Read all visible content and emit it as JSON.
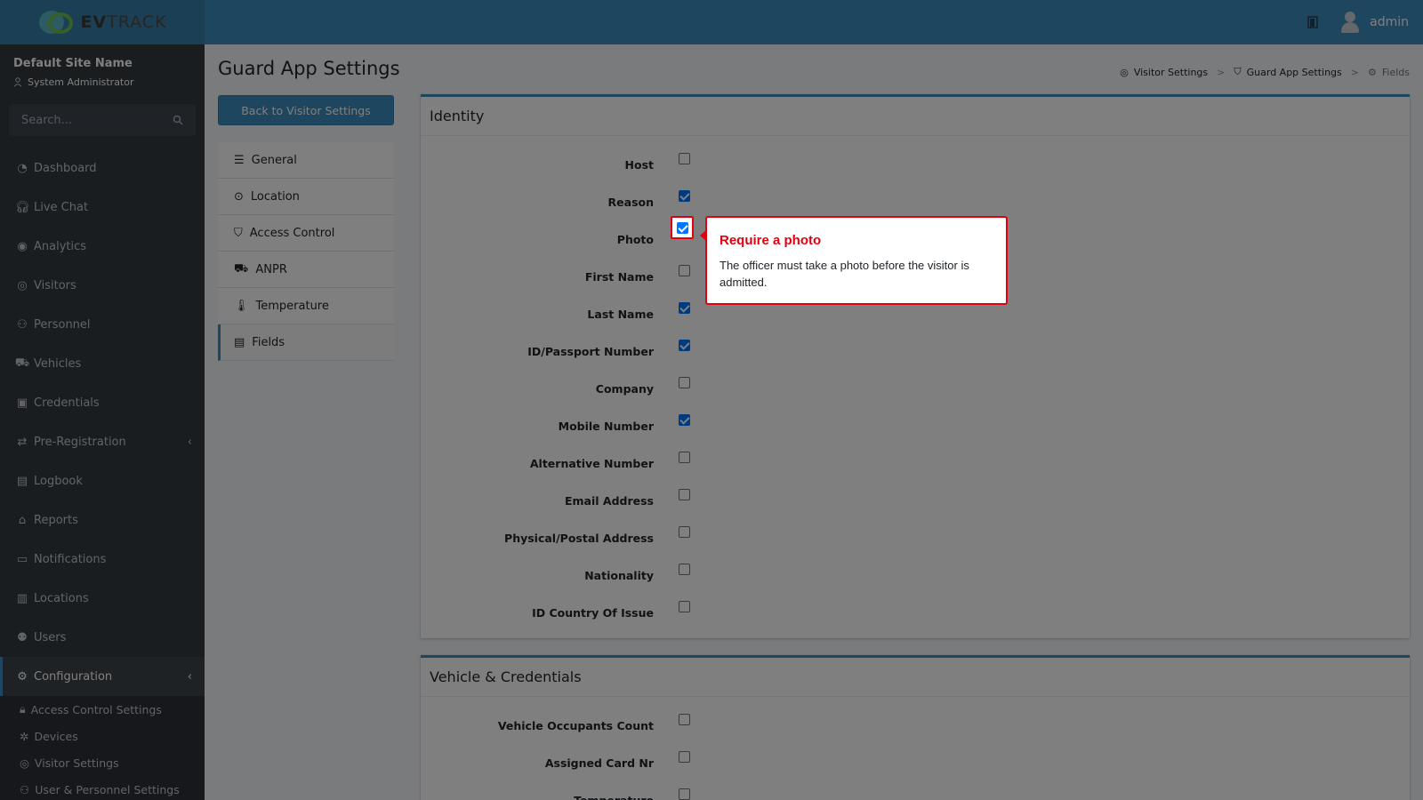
{
  "brand": {
    "name_bold": "EV",
    "name_rest": "TRACK"
  },
  "topbar": {
    "user": "admin"
  },
  "sidebar": {
    "site_name": "Default Site Name",
    "role": "System Administrator",
    "search_placeholder": "Search...",
    "items": [
      {
        "label": "Dashboard",
        "icon": "dashboard-icon"
      },
      {
        "label": "Live Chat",
        "icon": "headset-icon"
      },
      {
        "label": "Analytics",
        "icon": "analytics-icon"
      },
      {
        "label": "Visitors",
        "icon": "eye-icon"
      },
      {
        "label": "Personnel",
        "icon": "users-icon"
      },
      {
        "label": "Vehicles",
        "icon": "car-icon"
      },
      {
        "label": "Credentials",
        "icon": "id-card-icon"
      },
      {
        "label": "Pre-Registration",
        "icon": "arrows-icon"
      },
      {
        "label": "Logbook",
        "icon": "book-icon"
      },
      {
        "label": "Reports",
        "icon": "chart-icon"
      },
      {
        "label": "Notifications",
        "icon": "bell-icon"
      },
      {
        "label": "Locations",
        "icon": "map-icon"
      },
      {
        "label": "Users",
        "icon": "user-cog-icon"
      },
      {
        "label": "Configuration",
        "icon": "gear-icon"
      }
    ],
    "sub_items": [
      {
        "label": "Access Control Settings",
        "icon": "lock-icon"
      },
      {
        "label": "Devices",
        "icon": "chip-icon"
      },
      {
        "label": "Visitor Settings",
        "icon": "eye-icon"
      },
      {
        "label": "User & Personnel Settings",
        "icon": "user-icon"
      }
    ]
  },
  "page": {
    "title": "Guard App Settings",
    "back_button": "Back to Visitor Settings",
    "breadcrumb": [
      "Visitor Settings",
      "Guard App Settings",
      "Fields"
    ],
    "breadcrumb_sep": ">"
  },
  "settings_menu": [
    {
      "label": "General",
      "icon": "sliders-icon"
    },
    {
      "label": "Location",
      "icon": "pin-icon"
    },
    {
      "label": "Access Control",
      "icon": "shield-icon"
    },
    {
      "label": "ANPR",
      "icon": "car-icon"
    },
    {
      "label": "Temperature",
      "icon": "thermometer-icon"
    },
    {
      "label": "Fields",
      "icon": "form-icon"
    }
  ],
  "identity": {
    "title": "Identity",
    "fields": [
      {
        "label": "Host",
        "checked": false
      },
      {
        "label": "Reason",
        "checked": true
      },
      {
        "label": "Photo",
        "checked": true
      },
      {
        "label": "First Name",
        "checked": false
      },
      {
        "label": "Last Name",
        "checked": true
      },
      {
        "label": "ID/Passport Number",
        "checked": true
      },
      {
        "label": "Company",
        "checked": false
      },
      {
        "label": "Mobile Number",
        "checked": true
      },
      {
        "label": "Alternative Number",
        "checked": false
      },
      {
        "label": "Email Address",
        "checked": false
      },
      {
        "label": "Physical/Postal Address",
        "checked": false
      },
      {
        "label": "Nationality",
        "checked": false
      },
      {
        "label": "ID Country Of Issue",
        "checked": false
      }
    ]
  },
  "vehicle": {
    "title": "Vehicle & Credentials",
    "fields": [
      {
        "label": "Vehicle Occupants Count",
        "checked": false
      },
      {
        "label": "Assigned Card Nr",
        "checked": false
      },
      {
        "label": "Temperature",
        "checked": false
      }
    ]
  },
  "tooltip": {
    "title": "Require a photo",
    "body": "The officer must take a photo before the visitor is admitted."
  },
  "colors": {
    "primary": "#3c8dbc",
    "sidebar": "#343a40",
    "highlight": "#e0000f",
    "checkbox": "#0075ff"
  }
}
